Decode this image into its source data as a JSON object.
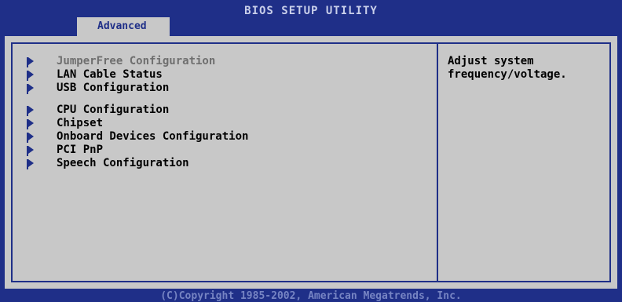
{
  "header": {
    "title": "BIOS SETUP UTILITY",
    "active_tab": "Advanced"
  },
  "menu": {
    "items": [
      {
        "label": "JumperFree Configuration",
        "selected": true
      },
      {
        "label": "LAN Cable Status",
        "selected": false
      },
      {
        "label": "USB Configuration",
        "selected": false
      },
      {
        "label": "CPU Configuration",
        "selected": false
      },
      {
        "label": "Chipset",
        "selected": false
      },
      {
        "label": "Onboard Devices Configuration",
        "selected": false
      },
      {
        "label": "PCI PnP",
        "selected": false
      },
      {
        "label": "Speech Configuration",
        "selected": false
      }
    ]
  },
  "help": {
    "text": "Adjust system\nfrequency/voltage."
  },
  "footer": {
    "copyright": "(C)Copyright 1985-2002, American Megatrends, Inc."
  },
  "colors": {
    "background_blue": "#1f2f88",
    "panel_gray": "#c8c8c8",
    "selected_text": "#6f6f6f",
    "footer_text": "#7684c3"
  }
}
